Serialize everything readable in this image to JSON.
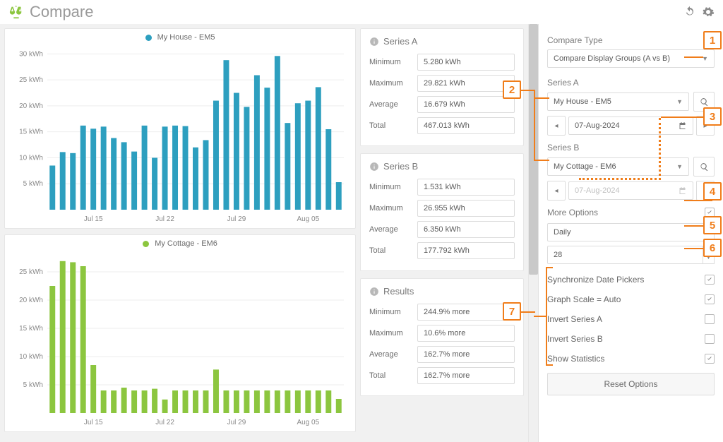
{
  "header": {
    "title": "Compare"
  },
  "chart_data": [
    {
      "type": "bar",
      "legend": "My House - EM5",
      "color": "#2d9fbf",
      "x_ticks": [
        "Jul 15",
        "Jul 22",
        "Jul 29",
        "Aug 05"
      ],
      "y_ticks": [
        5,
        10,
        15,
        20,
        25,
        30
      ],
      "y_unit": "kWh",
      "ylim": [
        0,
        31
      ],
      "values": [
        8.5,
        11.1,
        10.9,
        16.2,
        15.6,
        16.0,
        13.8,
        13.0,
        11.2,
        16.2,
        10.0,
        16.0,
        16.2,
        16.1,
        12.0,
        13.4,
        21.0,
        28.8,
        22.5,
        19.8,
        25.9,
        23.5,
        29.6,
        16.7,
        20.5,
        21.0,
        23.6,
        15.5,
        5.3
      ]
    },
    {
      "type": "bar",
      "legend": "My Cottage - EM6",
      "color": "#8cc63f",
      "x_ticks": [
        "Jul 15",
        "Jul 22",
        "Jul 29",
        "Aug 05"
      ],
      "y_ticks": [
        5,
        10,
        15,
        20,
        25
      ],
      "y_unit": "kWh",
      "ylim": [
        0,
        28
      ],
      "values": [
        22.5,
        26.9,
        26.7,
        26.0,
        8.5,
        4.0,
        4.0,
        4.5,
        4.0,
        4.0,
        4.3,
        2.4,
        4.0,
        4.0,
        4.0,
        4.0,
        7.7,
        4.0,
        4.0,
        4.0,
        4.0,
        4.0,
        4.0,
        4.0,
        4.0,
        4.0,
        4.0,
        4.0,
        2.5
      ]
    }
  ],
  "stats": {
    "seriesA": {
      "title": "Series A",
      "rows": {
        "min_label": "Minimum",
        "min": "5.280 kWh",
        "max_label": "Maximum",
        "max": "29.821 kWh",
        "avg_label": "Average",
        "avg": "16.679 kWh",
        "tot_label": "Total",
        "tot": "467.013 kWh"
      }
    },
    "seriesB": {
      "title": "Series B",
      "rows": {
        "min_label": "Minimum",
        "min": "1.531 kWh",
        "max_label": "Maximum",
        "max": "26.955 kWh",
        "avg_label": "Average",
        "avg": "6.350 kWh",
        "tot_label": "Total",
        "tot": "177.792 kWh"
      }
    },
    "results": {
      "title": "Results",
      "rows": {
        "min_label": "Minimum",
        "min": "244.9% more",
        "max_label": "Maximum",
        "max": "10.6% more",
        "avg_label": "Average",
        "avg": "162.7% more",
        "tot_label": "Total",
        "tot": "162.7% more"
      }
    }
  },
  "sidebar": {
    "compare_type_label": "Compare Type",
    "compare_type_value": "Compare Display Groups (A vs B)",
    "series_a_label": "Series A",
    "series_a_value": "My House - EM5",
    "series_a_date": "07-Aug-2024",
    "series_b_label": "Series B",
    "series_b_value": "My Cottage - EM6",
    "series_b_date": "07-Aug-2024",
    "more_options_label": "More Options",
    "interval_value": "Daily",
    "count_value": "28",
    "options": {
      "sync_label": "Synchronize Date Pickers",
      "scale_label": "Graph Scale = Auto",
      "invert_a_label": "Invert Series A",
      "invert_b_label": "Invert Series B",
      "show_stats_label": "Show Statistics"
    },
    "reset_label": "Reset Options"
  },
  "callouts": {
    "c1": "1",
    "c2": "2",
    "c3": "3",
    "c4": "4",
    "c5": "5",
    "c6": "6",
    "c7": "7"
  }
}
